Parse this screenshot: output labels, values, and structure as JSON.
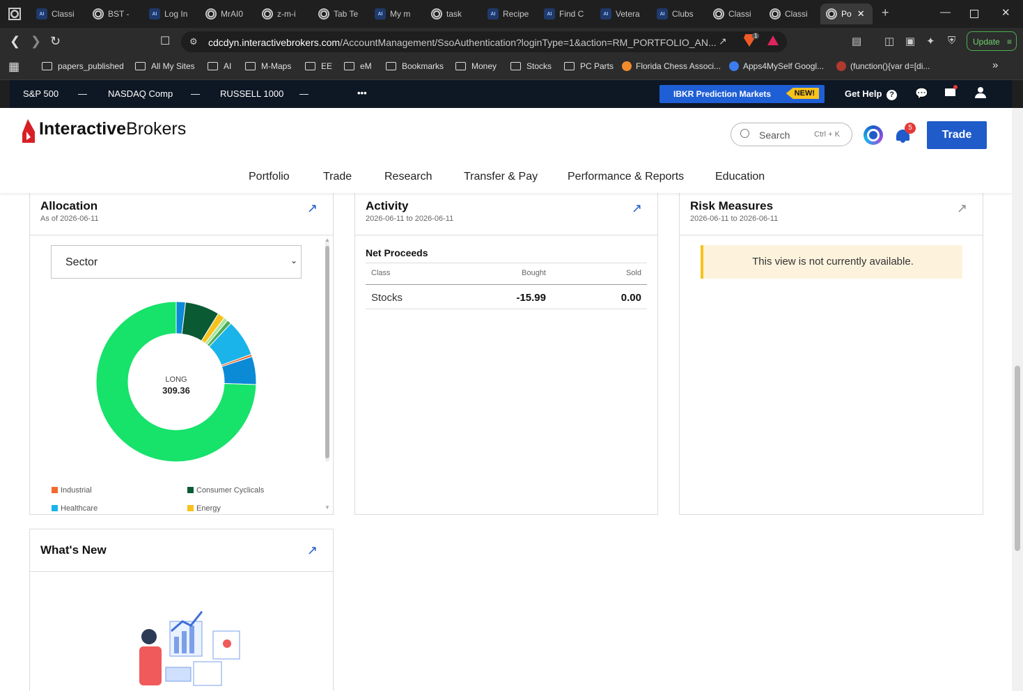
{
  "browser": {
    "tabs": [
      {
        "label": "Classi",
        "icon": "ai-icon"
      },
      {
        "label": "BST -",
        "icon": "globe-icon"
      },
      {
        "label": "Log In",
        "icon": "ai-icon"
      },
      {
        "label": "MrAI0",
        "icon": "globe-icon"
      },
      {
        "label": "z-m-i",
        "icon": "globe-icon"
      },
      {
        "label": "Tab Te",
        "icon": "globe-icon"
      },
      {
        "label": "My m",
        "icon": "ai-icon"
      },
      {
        "label": "task",
        "icon": "globe-icon"
      },
      {
        "label": "Recipe",
        "icon": "ai-icon"
      },
      {
        "label": "Find C",
        "icon": "ai-icon"
      },
      {
        "label": "Vetera",
        "icon": "ai-icon"
      },
      {
        "label": "Clubs",
        "icon": "ai-icon"
      },
      {
        "label": "Classi",
        "icon": "globe-icon"
      },
      {
        "label": "Classi",
        "icon": "globe-icon"
      },
      {
        "label": "Po",
        "icon": "globe-icon",
        "active": true
      }
    ],
    "url_domain": "cdcdyn.interactivebrokers.com",
    "url_path": "/AccountManagement/SsoAuthentication?loginType=1&action=RM_PORTFOLIO_AN...",
    "update_label": "Update",
    "brave_badge": "1",
    "bookmarks": [
      "papers_published",
      "All My Sites",
      "AI",
      "M-Maps",
      "EE",
      "eM",
      "Bookmarks",
      "Money",
      "Stocks",
      "PC Parts",
      "Florida Chess Associ...",
      "Apps4MySelf Googl...",
      "(function(){var d=[di..."
    ]
  },
  "ticker": {
    "items": [
      {
        "label": "S&P 500",
        "value": "—"
      },
      {
        "label": "NASDAQ Comp",
        "value": "—"
      },
      {
        "label": "RUSSELL 1000",
        "value": "—"
      }
    ],
    "more": "•••",
    "promo": "IBKR Prediction Markets",
    "promo_badge": "NEW!",
    "help": "Get Help"
  },
  "header": {
    "logo_bold": "Interactive",
    "logo_rest": "Brokers",
    "search_placeholder": "Search",
    "search_shortcut": "Ctrl + K",
    "notifications": "5",
    "trade": "Trade",
    "menu": [
      "Portfolio",
      "Trade",
      "Research",
      "Transfer & Pay",
      "Performance & Reports",
      "Education"
    ]
  },
  "allocation": {
    "title": "Allocation",
    "subtitle": "As of 2026-06-11",
    "select": "Sector",
    "center_label": "LONG",
    "center_value": "309.36",
    "legend": [
      {
        "name": "Industrial",
        "color": "#f26a2e"
      },
      {
        "name": "Consumer Cyclicals",
        "color": "#0a5a34"
      },
      {
        "name": "Healthcare",
        "color": "#1ab4ea"
      },
      {
        "name": "Energy",
        "color": "#f7c21c"
      }
    ]
  },
  "chart_data": {
    "type": "pie",
    "center_label": "LONG",
    "center_value": 309.36,
    "slices": [
      {
        "color": "#0b8ad6",
        "value": 5.8
      },
      {
        "color": "#0a5a34",
        "value": 21.5
      },
      {
        "color": "#f7c21c",
        "value": 4.5
      },
      {
        "color": "#a8e6a0",
        "value": 2.6
      },
      {
        "color": "#4cae5a",
        "value": 2.7
      },
      {
        "color": "#1ab4ea",
        "value": 23.0
      },
      {
        "color": "#f26a2e",
        "value": 1.5
      },
      {
        "color": "#0b8ad6",
        "value": 17.5
      },
      {
        "color": "#17e26a",
        "value": 230.26
      }
    ]
  },
  "activity": {
    "title": "Activity",
    "subtitle": "2026-06-11 to 2026-06-11",
    "section": "Net Proceeds",
    "columns": [
      "Class",
      "Bought",
      "Sold"
    ],
    "row": {
      "class": "Stocks",
      "bought": "-15.99",
      "sold": "0.00"
    }
  },
  "risk": {
    "title": "Risk Measures",
    "subtitle": "2026-06-11 to 2026-06-11",
    "message": "This view is not currently available."
  },
  "whats_new": {
    "title": "What's New"
  }
}
